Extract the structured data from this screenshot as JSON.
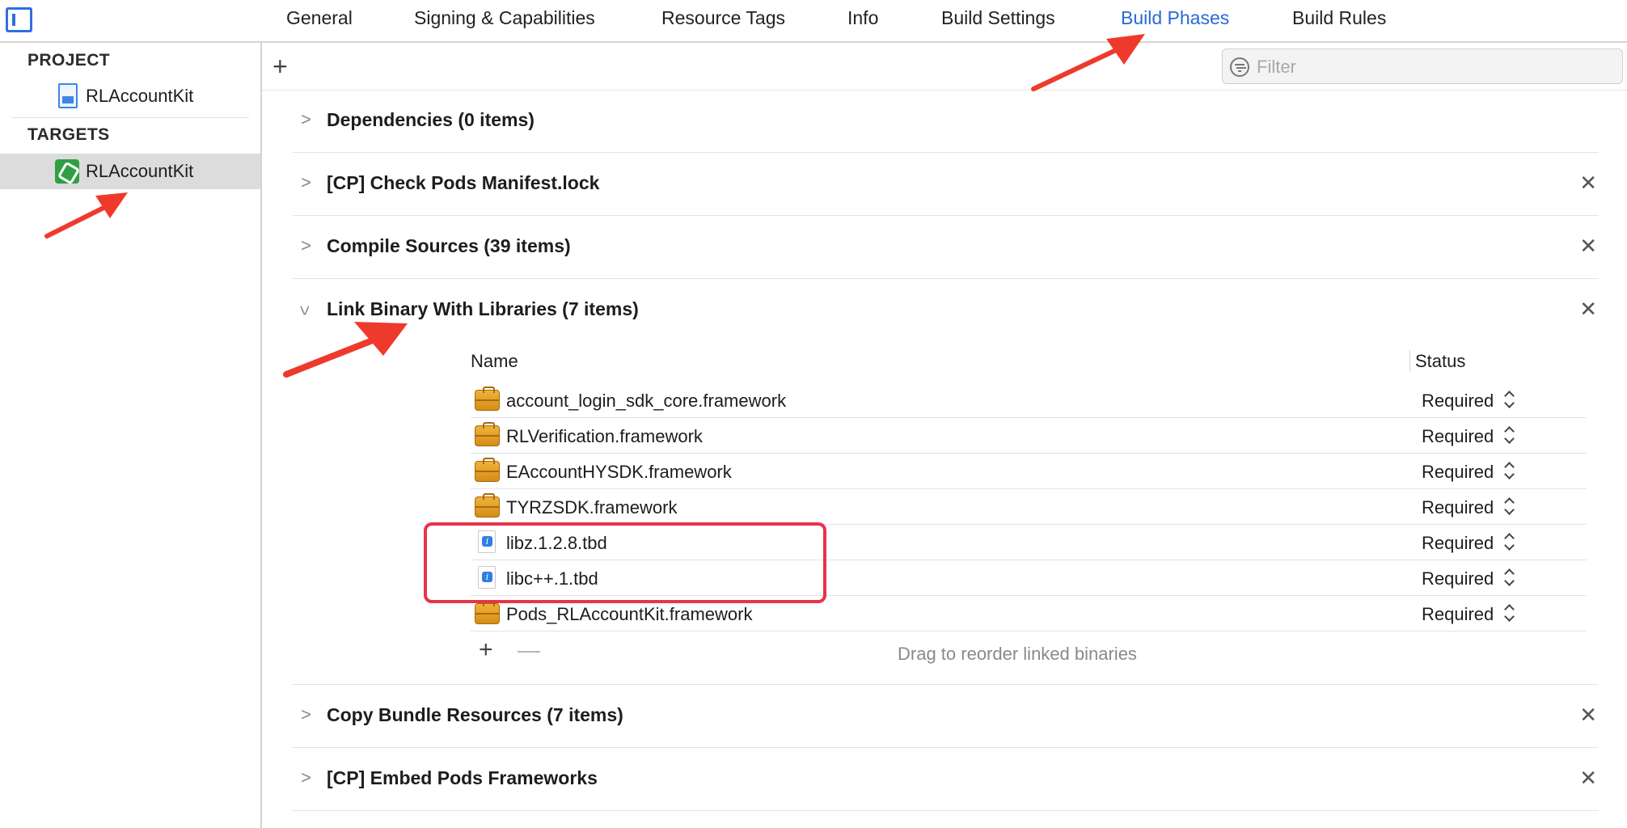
{
  "tabs": [
    {
      "label": "General",
      "active": false
    },
    {
      "label": "Signing & Capabilities",
      "active": false
    },
    {
      "label": "Resource Tags",
      "active": false
    },
    {
      "label": "Info",
      "active": false
    },
    {
      "label": "Build Settings",
      "active": false
    },
    {
      "label": "Build Phases",
      "active": true
    },
    {
      "label": "Build Rules",
      "active": false
    }
  ],
  "sidebar": {
    "project_header": "PROJECT",
    "project_item": "RLAccountKit",
    "targets_header": "TARGETS",
    "target_item": "RLAccountKit"
  },
  "filter": {
    "placeholder": "Filter",
    "value": ""
  },
  "phases": [
    {
      "title": "Dependencies (0 items)",
      "expanded": false,
      "removable": false
    },
    {
      "title": "[CP] Check Pods Manifest.lock",
      "expanded": false,
      "removable": true
    },
    {
      "title": "Compile Sources (39 items)",
      "expanded": false,
      "removable": true
    },
    {
      "title": "Link Binary With Libraries (7 items)",
      "expanded": true,
      "removable": true
    },
    {
      "title": "Copy Bundle Resources (7 items)",
      "expanded": false,
      "removable": true
    },
    {
      "title": "[CP] Embed Pods Frameworks",
      "expanded": false,
      "removable": true
    }
  ],
  "libraries": {
    "columns": {
      "name": "Name",
      "status": "Status"
    },
    "rows": [
      {
        "name": "account_login_sdk_core.framework",
        "status": "Required",
        "icon": "framework-icon"
      },
      {
        "name": "RLVerification.framework",
        "status": "Required",
        "icon": "framework-icon"
      },
      {
        "name": "EAccountHYSDK.framework",
        "status": "Required",
        "icon": "framework-icon"
      },
      {
        "name": "TYRZSDK.framework",
        "status": "Required",
        "icon": "framework-icon"
      },
      {
        "name": "libz.1.2.8.tbd",
        "status": "Required",
        "icon": "tbd-file-icon"
      },
      {
        "name": "libc++.1.tbd",
        "status": "Required",
        "icon": "tbd-file-icon"
      },
      {
        "name": "Pods_RLAccountKit.framework",
        "status": "Required",
        "icon": "framework-icon"
      }
    ],
    "drag_hint": "Drag to reorder linked binaries"
  },
  "colors": {
    "accent": "#2969d6",
    "annotation_red": "#e8334a",
    "selection_gray": "#dcdcdc",
    "target_green": "#2ea043"
  }
}
